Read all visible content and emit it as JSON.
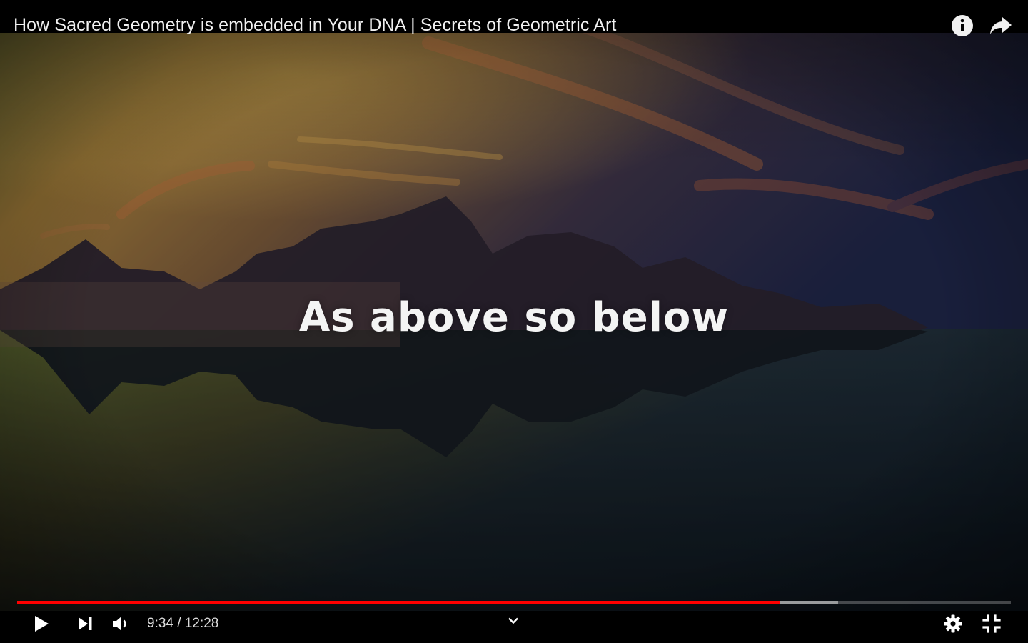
{
  "player": {
    "title": "How Sacred Geometry is embedded in Your DNA | Secrets of Geometric Art",
    "caption": "As above so below",
    "time_display": "9:34 / 12:28",
    "current_time": "9:34",
    "duration": "12:28",
    "progress_played_fraction": 0.767,
    "progress_buffered_fraction": 0.826,
    "colors": {
      "progress_played": "#ff0000",
      "controls_bar": "#000000",
      "text": "#ffffff"
    },
    "icons": {
      "info": "info-icon",
      "share": "share-icon",
      "play": "play-icon",
      "next": "next-icon",
      "volume": "volume-icon",
      "chevron": "chevron-down-icon",
      "settings": "gear-icon",
      "exit_fullscreen": "exit-fullscreen-icon"
    }
  }
}
